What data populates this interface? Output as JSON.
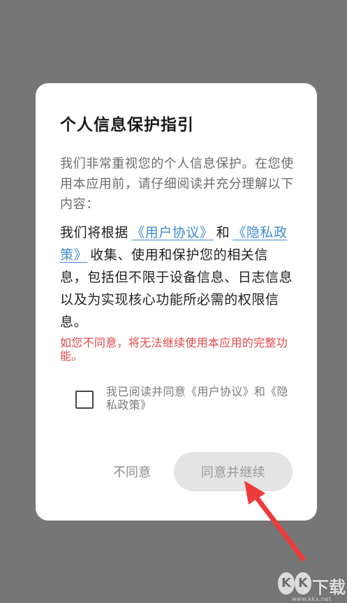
{
  "dialog": {
    "title": "个人信息保护指引",
    "intro": "我们非常重视您的个人信息保护。在您使用本应用前，请仔细阅读并充分理解以下内容：",
    "body_before": "我们将根据",
    "user_agreement_link": "《用户协议》",
    "body_and": "和",
    "privacy_policy_link": "《隐私政策》",
    "body_after": "收集、使用和保护您的相关信息，包括但不限于设备信息、日志信息以及为实现核心功能所必需的权限信息。",
    "warning": "如您不同意，将无法继续使用本应用的完整功能。",
    "consent_checkbox": {
      "checked": false,
      "label": "我已阅读并同意《用户协议》和《隐私政策》"
    },
    "disagree_button": "不同意",
    "agree_button": "同意并继续",
    "agree_button_disabled": true
  },
  "watermark": {
    "text": "KK下载",
    "letters": [
      "K",
      "K"
    ],
    "chars": [
      "下",
      "载"
    ],
    "subtext": "www.kkx.net"
  },
  "colors": {
    "backdrop": "#767676",
    "dialog_bg": "#ffffff",
    "link": "#3f8ad6",
    "warning": "#e04848",
    "button_disabled_bg": "#e4e4e4",
    "arrow": "#ef3b3b"
  },
  "icons": {
    "annotation_arrow": "red-arrow-icon",
    "checkbox": "checkbox-unchecked-icon"
  }
}
